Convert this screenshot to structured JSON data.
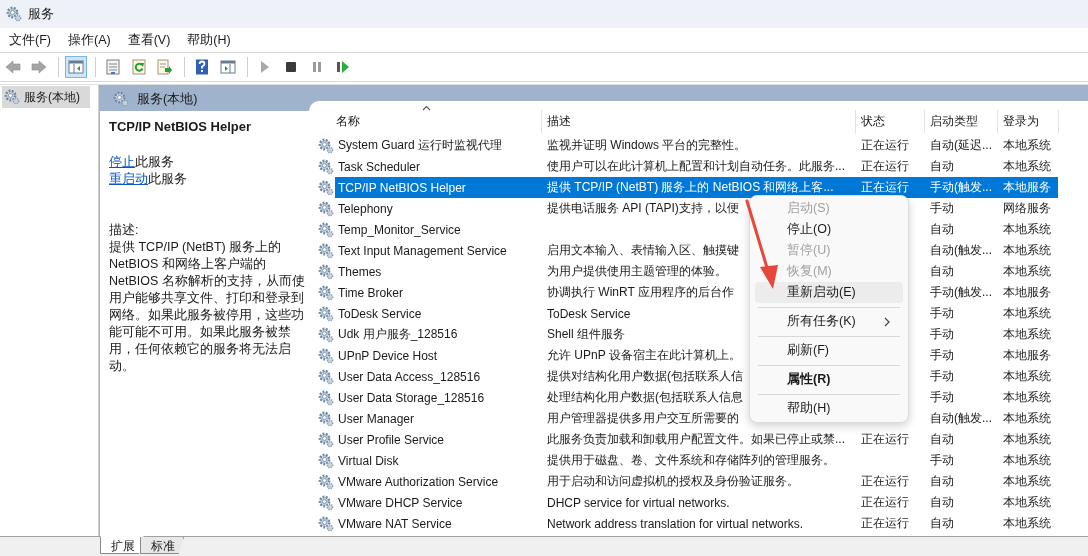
{
  "window": {
    "title": "服务"
  },
  "menu_bar": [
    {
      "label": "文件(F)"
    },
    {
      "label": "操作(A)"
    },
    {
      "label": "查看(V)"
    },
    {
      "label": "帮助(H)"
    }
  ],
  "toolbar": [
    {
      "kind": "back",
      "disabled": true,
      "selected": false
    },
    {
      "kind": "forward",
      "disabled": true,
      "selected": false
    },
    {
      "kind": "separator"
    },
    {
      "kind": "console-tree",
      "disabled": false,
      "selected": true
    },
    {
      "kind": "separator"
    },
    {
      "kind": "properties",
      "disabled": false,
      "selected": false
    },
    {
      "kind": "refresh",
      "disabled": false,
      "selected": false
    },
    {
      "kind": "export",
      "disabled": false,
      "selected": false
    },
    {
      "kind": "separator"
    },
    {
      "kind": "help",
      "disabled": false,
      "selected": false
    },
    {
      "kind": "view",
      "disabled": false,
      "selected": false
    },
    {
      "kind": "separator"
    },
    {
      "kind": "start",
      "disabled": true,
      "selected": false
    },
    {
      "kind": "stop",
      "disabled": false,
      "selected": false
    },
    {
      "kind": "pause",
      "disabled": true,
      "selected": false
    },
    {
      "kind": "resume",
      "disabled": false,
      "selected": false
    }
  ],
  "tree": [
    {
      "label": "服务(本地)",
      "selected": true
    }
  ],
  "pane_header": {
    "title": "服务(本地)"
  },
  "detail": {
    "title": "TCP/IP NetBIOS Helper",
    "actions": [
      {
        "link": "停止",
        "text": "此服务"
      },
      {
        "link": "重启动",
        "text": "此服务"
      }
    ],
    "description_label": "描述:",
    "description": "提供 TCP/IP (NetBT) 服务上的 NetBIOS 和网络上客户端的 NetBIOS 名称解析的支持，从而使用户能够共享文件、打印和登录到网络。如果此服务被停用，这些功能可能不可用。如果此服务被禁用，任何依赖它的服务将无法启动。"
  },
  "table": {
    "columns": [
      {
        "label": "名称",
        "sorted": true
      },
      {
        "label": "描述",
        "sorted": false
      },
      {
        "label": "状态",
        "sorted": false
      },
      {
        "label": "启动类型",
        "sorted": false
      },
      {
        "label": "登录为",
        "sorted": false
      }
    ],
    "rows": [
      {
        "name": "System Guard 运行时监视代理",
        "description": "监视并证明 Windows 平台的完整性。",
        "status": "正在运行",
        "startup": "自动(延迟...",
        "logon": "本地系统",
        "selected": false
      },
      {
        "name": "Task Scheduler",
        "description": "使用户可以在此计算机上配置和计划自动任务。此服务...",
        "status": "正在运行",
        "startup": "自动",
        "logon": "本地系统",
        "selected": false
      },
      {
        "name": "TCP/IP NetBIOS Helper",
        "description": "提供 TCP/IP (NetBT) 服务上的 NetBIOS 和网络上客...",
        "status": "正在运行",
        "startup": "手动(触发...",
        "logon": "本地服务",
        "selected": true
      },
      {
        "name": "Telephony",
        "description": "提供电话服务 API (TAPI)支持，以便",
        "startup": "手动",
        "logon": "网络服务",
        "selected": false
      },
      {
        "name": "Temp_Monitor_Service",
        "startup": "自动",
        "logon": "本地系统",
        "selected": false
      },
      {
        "name": "Text Input Management Service",
        "description": "启用文本输入、表情输入区、触摸键",
        "startup": "自动(触发...",
        "logon": "本地系统",
        "selected": false
      },
      {
        "name": "Themes",
        "description": "为用户提供使用主题管理的体验。",
        "startup": "自动",
        "logon": "本地系统",
        "selected": false
      },
      {
        "name": "Time Broker",
        "description": "协调执行 WinRT 应用程序的后台作",
        "startup": "手动(触发...",
        "logon": "本地服务",
        "selected": false
      },
      {
        "name": "ToDesk Service",
        "description": "ToDesk Service",
        "startup": "手动",
        "logon": "本地系统",
        "selected": false
      },
      {
        "name": "Udk 用户服务_128516",
        "description": "Shell 组件服务",
        "startup": "手动",
        "logon": "本地系统",
        "selected": false
      },
      {
        "name": "UPnP Device Host",
        "description": "允许 UPnP 设备宿主在此计算机上。",
        "startup": "手动",
        "logon": "本地服务",
        "selected": false
      },
      {
        "name": "User Data Access_128516",
        "description": "提供对结构化用户数据(包括联系人信",
        "startup": "手动",
        "logon": "本地系统",
        "selected": false
      },
      {
        "name": "User Data Storage_128516",
        "description": "处理结构化用户数据(包括联系人信息",
        "startup": "手动",
        "logon": "本地系统",
        "selected": false
      },
      {
        "name": "User Manager",
        "description": "用户管理器提供多用户交互所需要的",
        "startup": "自动(触发...",
        "logon": "本地系统",
        "selected": false
      },
      {
        "name": "User Profile Service",
        "description": "此服务负责加载和卸载用户配置文件。如果已停止或禁...",
        "status": "正在运行",
        "startup": "自动",
        "logon": "本地系统",
        "selected": false
      },
      {
        "name": "Virtual Disk",
        "description": "提供用于磁盘、卷、文件系统和存储阵列的管理服务。",
        "startup": "手动",
        "logon": "本地系统",
        "selected": false
      },
      {
        "name": "VMware Authorization Service",
        "description": "用于启动和访问虚拟机的授权及身份验证服务。",
        "status": "正在运行",
        "startup": "自动",
        "logon": "本地系统",
        "selected": false
      },
      {
        "name": "VMware DHCP Service",
        "description": "DHCP service for virtual networks.",
        "status": "正在运行",
        "startup": "自动",
        "logon": "本地系统",
        "selected": false
      },
      {
        "name": "VMware NAT Service",
        "description": "Network address translation for virtual networks.",
        "status": "正在运行",
        "startup": "自动",
        "logon": "本地系统",
        "selected": false
      }
    ]
  },
  "context_menu": {
    "items": [
      {
        "kind": "item",
        "label": "启动(S)",
        "disabled": true,
        "selected": false,
        "default": false,
        "submenu": false
      },
      {
        "kind": "item",
        "label": "停止(O)",
        "disabled": false,
        "selected": false,
        "default": false,
        "submenu": false
      },
      {
        "kind": "item",
        "label": "暂停(U)",
        "disabled": true,
        "selected": false,
        "default": false,
        "submenu": false
      },
      {
        "kind": "item",
        "label": "恢复(M)",
        "disabled": true,
        "selected": false,
        "default": false,
        "submenu": false
      },
      {
        "kind": "item",
        "label": "重新启动(E)",
        "disabled": false,
        "selected": true,
        "default": false,
        "submenu": false
      },
      {
        "kind": "separator"
      },
      {
        "kind": "item",
        "label": "所有任务(K)",
        "disabled": false,
        "selected": false,
        "default": false,
        "submenu": true
      },
      {
        "kind": "separator"
      },
      {
        "kind": "item",
        "label": "刷新(F)",
        "disabled": false,
        "selected": false,
        "default": false,
        "submenu": false
      },
      {
        "kind": "separator"
      },
      {
        "kind": "item",
        "label": "属性(R)",
        "disabled": false,
        "selected": false,
        "default": true,
        "submenu": false
      },
      {
        "kind": "separator"
      },
      {
        "kind": "item",
        "label": "帮助(H)",
        "disabled": false,
        "selected": false,
        "default": false,
        "submenu": false
      }
    ]
  },
  "bottom_tabs": [
    {
      "label": "扩展",
      "selected": true
    },
    {
      "label": "标准",
      "selected": false
    }
  ]
}
